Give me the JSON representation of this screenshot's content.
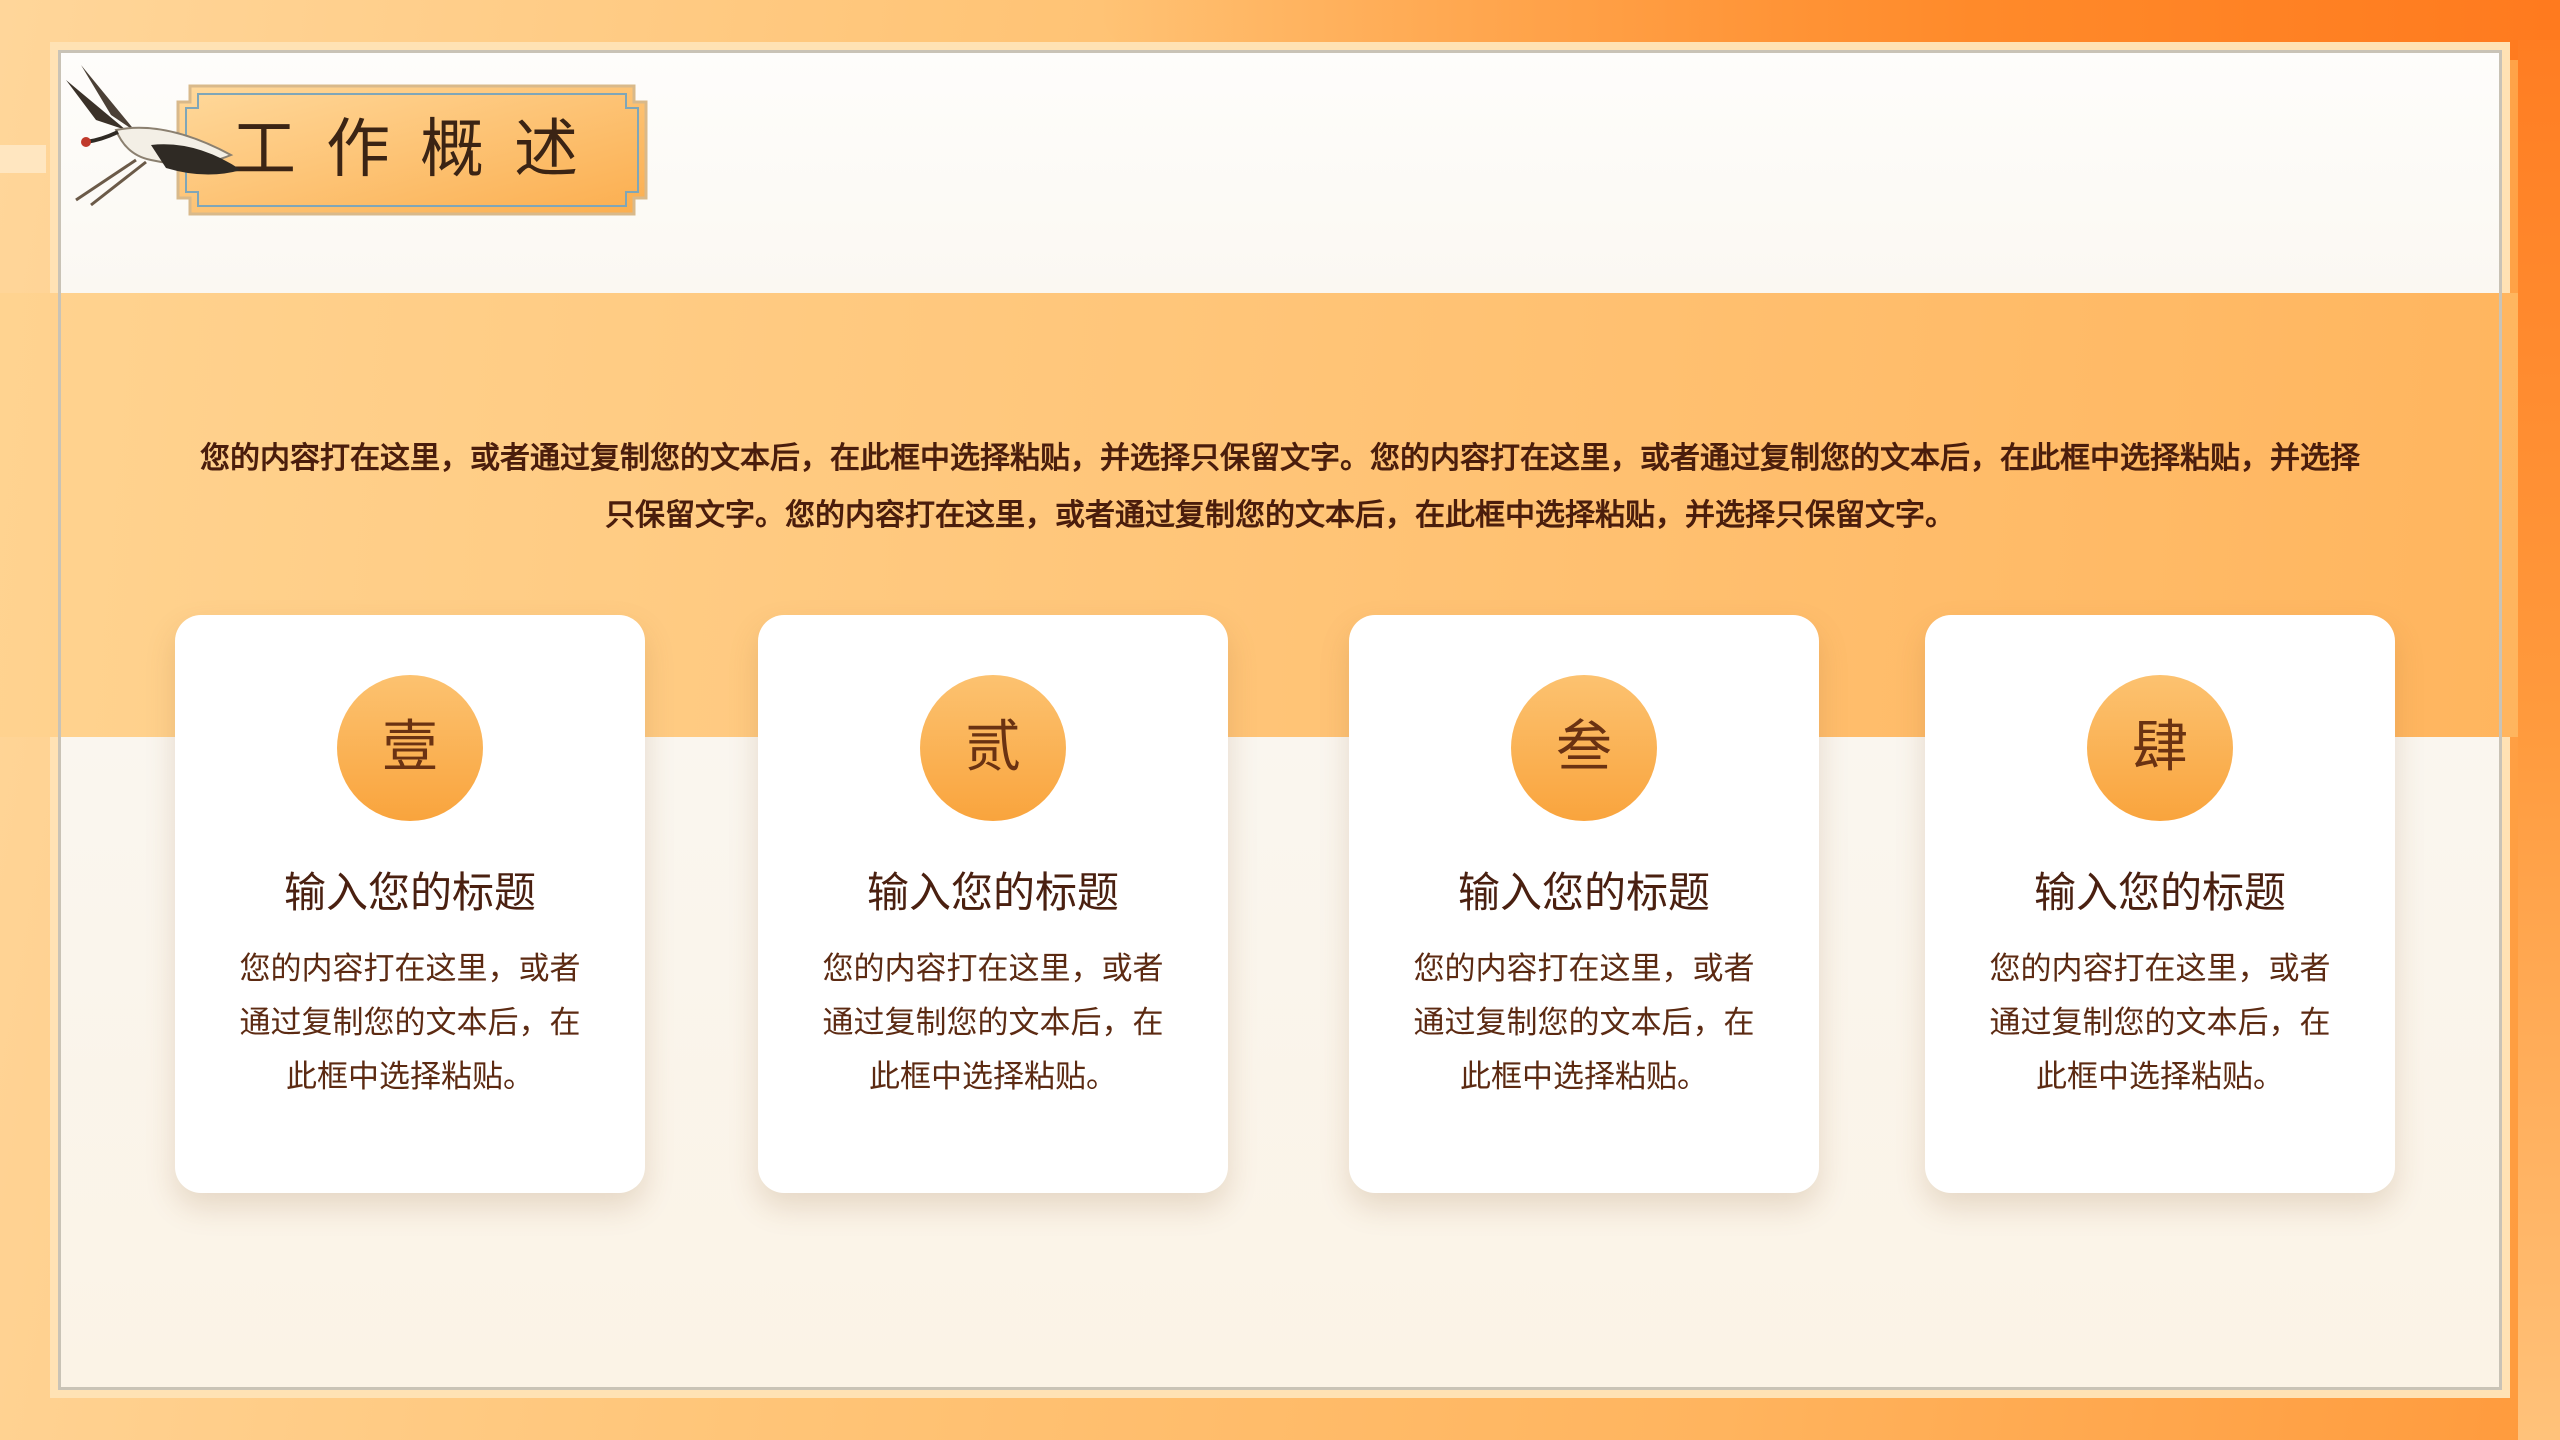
{
  "slide": {
    "title": "工作概述",
    "intro": "您的内容打在这里，或者通过复制您的文本后，在此框中选择粘贴，并选择只保留文字。您的内容打在这里，或者通过复制您的文本后，在此框中选择粘贴，并选择只保留文字。您的内容打在这里，或者通过复制您的文本后，在此框中选择粘贴，并选择只保留文字。"
  },
  "cards": [
    {
      "badge": "壹",
      "title": "输入您的标题",
      "body": "您的内容打在这里，或者通过复制您的文本后，在此框中选择粘贴。"
    },
    {
      "badge": "贰",
      "title": "输入您的标题",
      "body": "您的内容打在这里，或者通过复制您的文本后，在此框中选择粘贴。"
    },
    {
      "badge": "叁",
      "title": "输入您的标题",
      "body": "您的内容打在这里，或者通过复制您的文本后，在此框中选择粘贴。"
    },
    {
      "badge": "肆",
      "title": "输入您的标题",
      "body": "您的内容打在这里，或者通过复制您的文本后，在此框中选择粘贴。"
    }
  ],
  "colors": {
    "accent": "#ffb45e",
    "badge": "#f9a43d",
    "text_dark": "#4a2010"
  },
  "icons": [
    "crane-icon"
  ]
}
